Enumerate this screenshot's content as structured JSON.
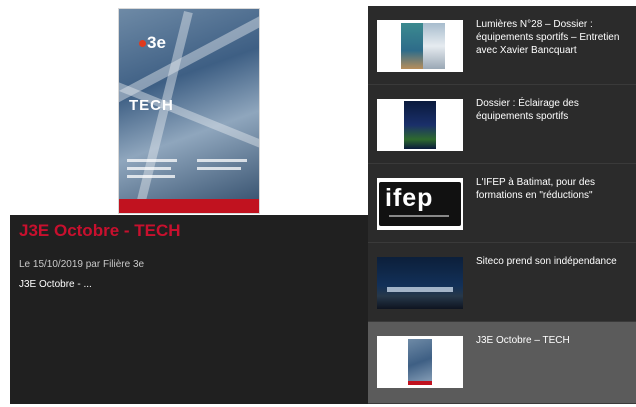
{
  "featured": {
    "title": "J3E Octobre - TECH",
    "meta": "Le 15/10/2019 par Filière 3e",
    "excerpt": "J3E Octobre - ...",
    "cover": {
      "logo_text": "3e",
      "headline": "TECH"
    }
  },
  "list": {
    "items": [
      {
        "label": "Lumières N°28 – Dossier : équipements sportifs – Entretien avec Xavier Bancquart",
        "thumb": "magazine-cover",
        "active": false
      },
      {
        "label": "Dossier : Éclairage des équipements sportifs",
        "thumb": "stadium-night",
        "active": false
      },
      {
        "label": "L'IFEP à Batimat, pour des formations en \"réductions\"",
        "thumb": "ifep-logo",
        "active": false
      },
      {
        "label": "Siteco prend son indépendance",
        "thumb": "building-night",
        "active": false
      },
      {
        "label": "J3E Octobre – TECH",
        "thumb": "magazine-cover-small",
        "active": true
      }
    ],
    "ifep_logo_text": "ifep"
  },
  "colors": {
    "title_red": "#c8102e",
    "panel_dark": "#202020",
    "list_bg": "#2b2b2b",
    "active_bg": "#5b5b5b"
  }
}
